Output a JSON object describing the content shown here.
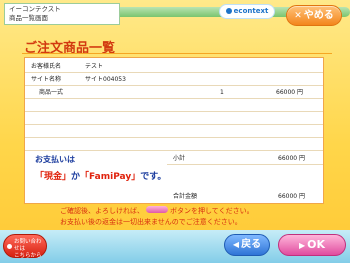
{
  "header": {
    "app_name": "イーコンテクスト",
    "screen_name": "商品一覧画面",
    "brand_logo": "econtext",
    "cancel_label": "やめる"
  },
  "page_title": "ご注文商品一覧",
  "order": {
    "customer_label": "お客様氏名",
    "customer_name": "テスト",
    "site_label": "サイト名称",
    "site_name": "サイト004053",
    "item_label": "商品一式",
    "item_qty": "1",
    "item_amount": "66000 円",
    "subtotal_label": "小計",
    "subtotal_amount": "66000 円",
    "total_label": "合計金額",
    "total_amount": "66000 円"
  },
  "payment_note": {
    "line1": "お支払いは",
    "option1": "「現金」",
    "joiner": "か",
    "option2": "「FamiPay」",
    "suffix": "です。"
  },
  "notice": {
    "line1_a": "ご確認後、よろしければ、",
    "line1_b": "ボタンを押してください。",
    "line2": "お支払い後の返金は一切出来ませんのでご注意ください。"
  },
  "footer": {
    "inquiry_line1": "お問い合わせは",
    "inquiry_line2": "こちらから",
    "back_label": "戻る",
    "ok_label": "OK"
  },
  "colors": {
    "background": "#ffd64a",
    "title": "#d23a10",
    "accent_pink": "#e04c9e",
    "accent_blue": "#2f74d6"
  }
}
